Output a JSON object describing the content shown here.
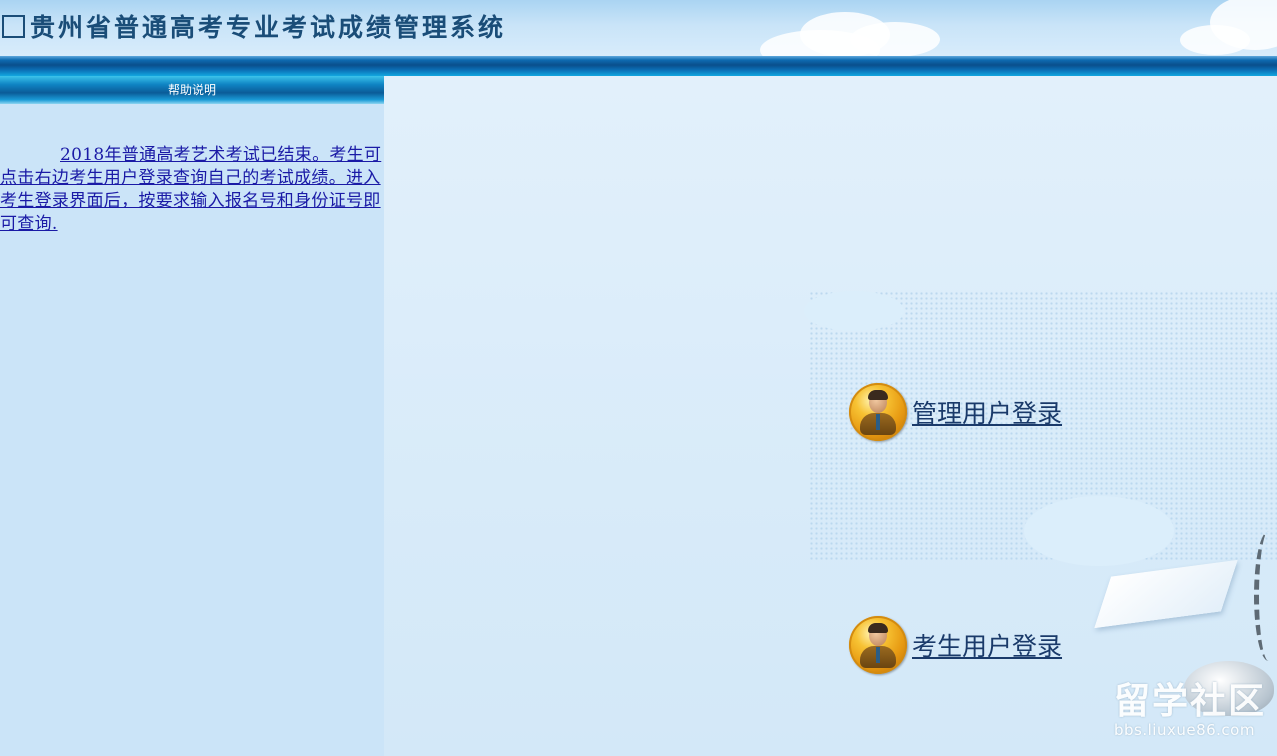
{
  "header": {
    "title": "贵州省普通高考专业考试成绩管理系统"
  },
  "sidebar": {
    "heading": "帮助说明",
    "notice": "2018年普通高考艺术考试已结束。考生可点击右边考生用户登录查询自己的考试成绩。进入考生登录界面后，按要求输入报名号和身份证号即可查询."
  },
  "main": {
    "admin_login": {
      "label": "管理用户登录",
      "icon": "user-avatar-icon"
    },
    "student_login": {
      "label": "考生用户登录",
      "icon": "user-avatar-icon"
    }
  },
  "watermark": {
    "brand": "留学社区",
    "url": "bbs.liuxue86.com"
  },
  "colors": {
    "header_band": "#0a4f8c",
    "left_panel_bg": "#cbe4f8",
    "right_panel_bg": "#dbeefb",
    "link": "#1a1aa6",
    "title": "#1a4d78"
  }
}
